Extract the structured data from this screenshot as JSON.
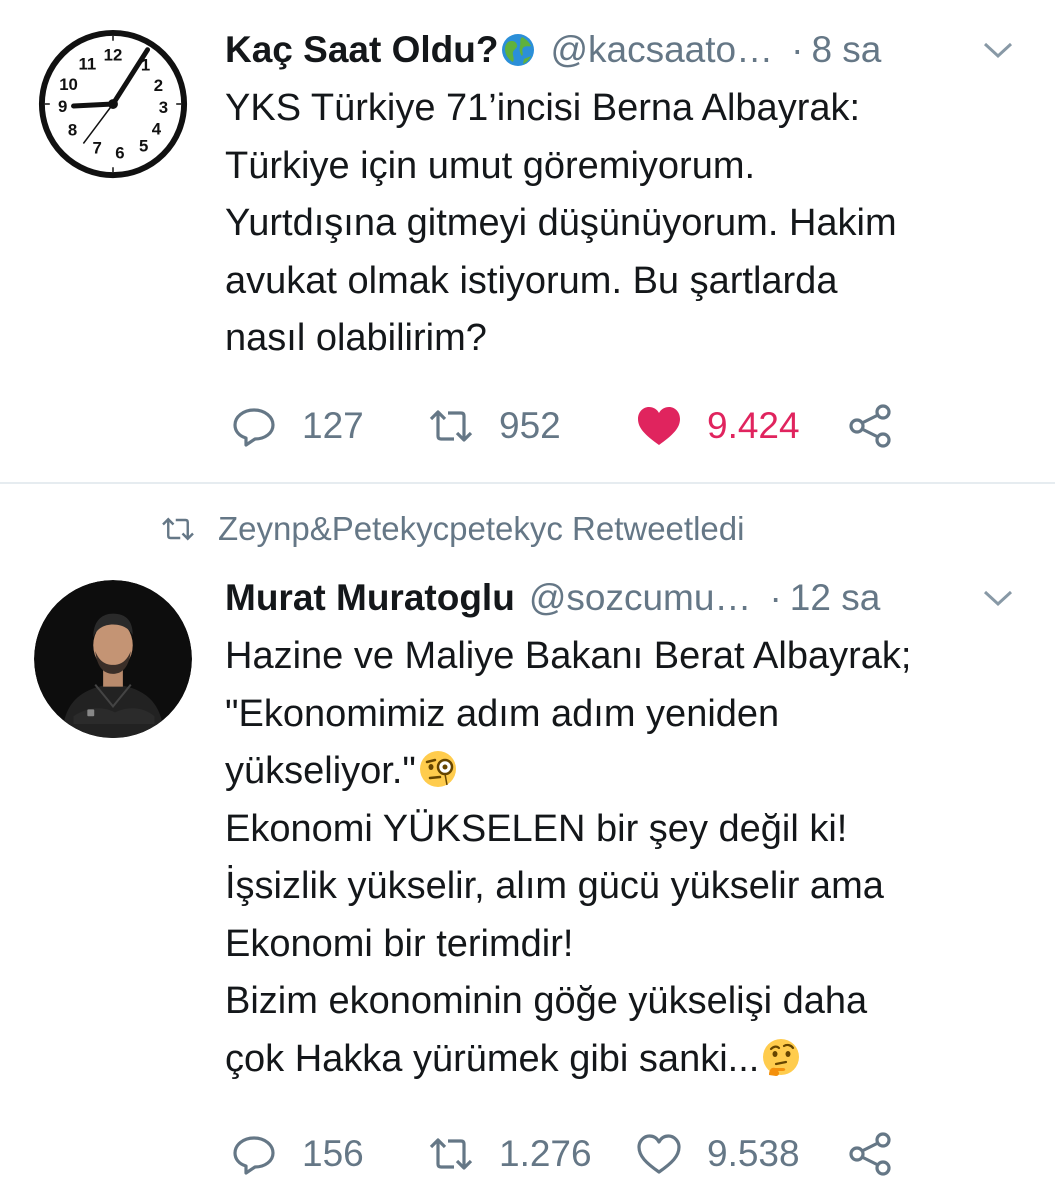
{
  "tweets": [
    {
      "author_name": "Kaç Saat Oldu?",
      "author_handle": "@kacsaato…",
      "time": "8 sa",
      "avatar_icon": "clock-avatar",
      "text_lines": [
        "YKS Türkiye 71’incisi Berna Albayrak:",
        "Türkiye için umut göremiyorum.",
        "Yurtdışına gitmeyi düşünüyorum. Hakim",
        "avukat olmak istiyorum. Bu şartlarda",
        "nasıl olabilirim?"
      ],
      "replies": "127",
      "retweets": "952",
      "likes": "9.424",
      "liked": true
    },
    {
      "retweeted_by": "Zeynp&Petekycpetekyc Retweetledi",
      "author_name": "Murat Muratoglu",
      "author_handle": "@sozcumu…",
      "time": "12 sa",
      "avatar_icon": "man-photo-avatar",
      "text_lines": [
        "Hazine ve Maliye Bakanı Berat Albayrak;",
        "\"Ekonomimiz adım adım yeniden",
        "yükseliyor.\"",
        "Ekonomi YÜKSELEN bir şey değil ki!",
        "İşsizlik yükselir, alım gücü yükselir ama",
        "Ekonomi bir terimdir!",
        "Bizim ekonominin göğe yükselişi daha",
        "çok Hakka yürümek gibi sanki..."
      ],
      "replies": "156",
      "retweets": "1.276",
      "likes": "9.538",
      "liked": false
    }
  ],
  "colors": {
    "text": "#14171a",
    "secondary": "#657786",
    "like_red": "#e0245e",
    "divider": "#e6ecf0"
  }
}
